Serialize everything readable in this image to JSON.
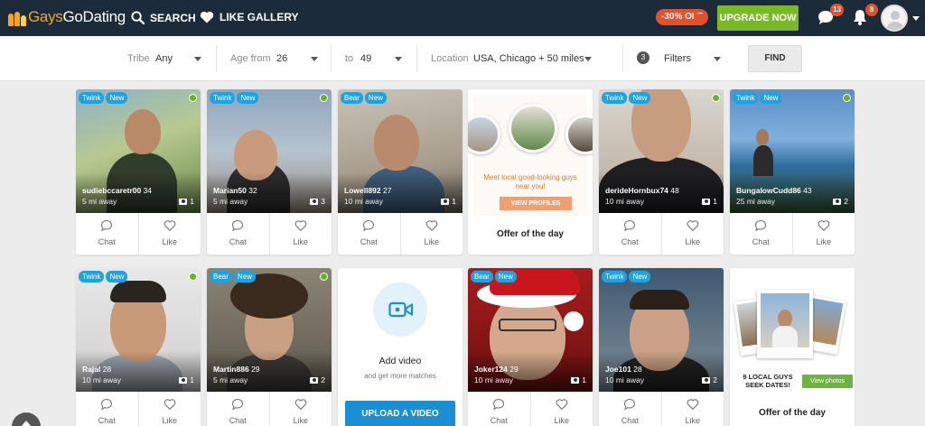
{
  "nav": {
    "logo_part1": "Gays",
    "logo_part2": "GoDating",
    "search_label": "SEARCH",
    "like_gallery_label": "LIKE GALLERY",
    "promo_label": "-30% OFF",
    "upgrade_label": "UPGRADE NOW",
    "messages_count": "13",
    "notifications_count": "8"
  },
  "filters": {
    "tribe_label": "Tribe",
    "tribe_value": "Any",
    "age_from_label": "Age from",
    "age_from_value": "26",
    "age_to_label": "to",
    "age_to_value": "49",
    "location_label": "Location",
    "location_value": "USA, Chicago + 50 miles",
    "filters_count": "3",
    "filters_label": "Filters",
    "find_label": "FIND"
  },
  "actions": {
    "chat": "Chat",
    "like": "Like"
  },
  "profiles": [
    {
      "tags": [
        "Twink",
        "New"
      ],
      "name": "sudiebccaretr00",
      "age": "34",
      "distance": "5 mi away",
      "photos": "1"
    },
    {
      "tags": [
        "Twink",
        "New"
      ],
      "name": "Marian50",
      "age": "32",
      "distance": "5 mi away",
      "photos": "3"
    },
    {
      "tags": [
        "Bear",
        "New"
      ],
      "name": "Lowell892",
      "age": "27",
      "distance": "10 mi away",
      "photos": "1"
    },
    {
      "tags": [
        "Twink",
        "New"
      ],
      "name": "derideHornbux74",
      "age": "48",
      "distance": "10 mi away",
      "photos": "1"
    },
    {
      "tags": [
        "Twink",
        "New"
      ],
      "name": "BungalowCudd86",
      "age": "43",
      "distance": "25 mi away",
      "photos": "2"
    },
    {
      "tags": [
        "Twink",
        "New"
      ],
      "name": "Rajal",
      "age": "28",
      "distance": "10 mi away",
      "photos": "1"
    },
    {
      "tags": [
        "Bear",
        "New"
      ],
      "name": "Martin886",
      "age": "29",
      "distance": "5 mi away",
      "photos": "2"
    },
    {
      "tags": [
        "Bear",
        "New"
      ],
      "name": "Joker124",
      "age": "29",
      "distance": "10 mi away",
      "photos": "1"
    },
    {
      "tags": [
        "Twink",
        "New"
      ],
      "name": "Joe101",
      "age": "28",
      "distance": "10 mi away",
      "photos": "2"
    }
  ],
  "offer1": {
    "title": "Offer of the day",
    "ad_text": "Meet local good-looking guys near you!",
    "ad_button": "VIEW PROFILES"
  },
  "offer2": {
    "title": "Offer of the day",
    "ad_text": "9 LOCAL GUYS SEEK DATES!",
    "ad_button": "View photos"
  },
  "video": {
    "title": "Add video",
    "subtitle": "and get more matches",
    "button": "UPLOAD A VIDEO"
  },
  "colors": {
    "topbar": "#1c2b39",
    "accent_blue": "#1fa3e0",
    "upgrade_green": "#7bb825",
    "badge_red": "#e4502c",
    "online_green": "#67b421"
  }
}
